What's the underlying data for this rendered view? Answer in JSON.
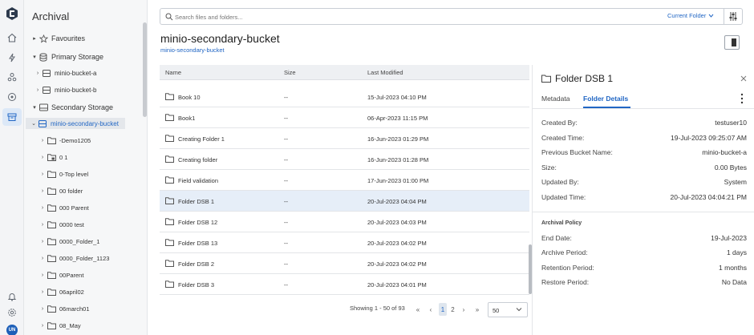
{
  "sidebar": {
    "title": "Archival",
    "user_initials": "UN",
    "tree": [
      {
        "label": "Favourites",
        "caret": "▸",
        "icon": "star-icon",
        "level": 1
      },
      {
        "label": "Primary Storage",
        "caret": "▾",
        "icon": "database-icon",
        "level": 1
      },
      {
        "label": "minio-bucket-a",
        "caret": "›",
        "icon": "bucket-icon",
        "level": 2
      },
      {
        "label": "minio-bucket-b",
        "caret": "›",
        "icon": "bucket-icon",
        "level": 2
      },
      {
        "label": "Secondary Storage",
        "caret": "▾",
        "icon": "storage-icon",
        "level": 1
      },
      {
        "label": "minio-secondary-bucket",
        "caret": "⌄",
        "icon": "bucket-icon",
        "level": 2,
        "selected": true
      },
      {
        "label": "-Demo1205",
        "caret": "›",
        "icon": "folder-icon",
        "level": 3
      },
      {
        "label": "0 1",
        "caret": "›",
        "icon": "folder-lock-icon",
        "level": 3
      },
      {
        "label": "0-Top level",
        "caret": "›",
        "icon": "folder-icon",
        "level": 3
      },
      {
        "label": "00 folder",
        "caret": "›",
        "icon": "folder-icon",
        "level": 3
      },
      {
        "label": "000 Parent",
        "caret": "›",
        "icon": "folder-icon",
        "level": 3
      },
      {
        "label": "0000 test",
        "caret": "›",
        "icon": "folder-icon",
        "level": 3
      },
      {
        "label": "0000_Folder_1",
        "caret": "›",
        "icon": "folder-icon",
        "level": 3
      },
      {
        "label": "0000_Folder_1123",
        "caret": "›",
        "icon": "folder-icon",
        "level": 3
      },
      {
        "label": "00Parent",
        "caret": "›",
        "icon": "folder-icon",
        "level": 3
      },
      {
        "label": "06april02",
        "caret": "›",
        "icon": "folder-icon",
        "level": 3
      },
      {
        "label": "06march01",
        "caret": "›",
        "icon": "folder-icon",
        "level": 3
      },
      {
        "label": "08_May",
        "caret": "›",
        "icon": "folder-icon",
        "level": 3
      }
    ]
  },
  "search": {
    "placeholder": "Search files and folders...",
    "scope": "Current Folder"
  },
  "main": {
    "title": "minio-secondary-bucket",
    "breadcrumb": "minio-secondary-bucket"
  },
  "table": {
    "headers": {
      "name": "Name",
      "size": "Size",
      "modified": "Last Modified"
    },
    "rows": [
      {
        "name": "Book 10",
        "size": "--",
        "modified": "15-Jul-2023 04:10 PM"
      },
      {
        "name": "Book1",
        "size": "--",
        "modified": "06-Apr-2023 11:15 PM"
      },
      {
        "name": "Creating Folder 1",
        "size": "--",
        "modified": "16-Jun-2023 01:29 PM"
      },
      {
        "name": "Creating folder",
        "size": "--",
        "modified": "16-Jun-2023 01:28 PM"
      },
      {
        "name": "Field validation",
        "size": "--",
        "modified": "17-Jun-2023 01:00 PM"
      },
      {
        "name": "Folder DSB 1",
        "size": "--",
        "modified": "20-Jul-2023 04:04 PM",
        "selected": true
      },
      {
        "name": "Folder DSB 12",
        "size": "--",
        "modified": "20-Jul-2023 04:03 PM"
      },
      {
        "name": "Folder DSB 13",
        "size": "--",
        "modified": "20-Jul-2023 04:02 PM"
      },
      {
        "name": "Folder DSB 2",
        "size": "--",
        "modified": "20-Jul-2023 04:02 PM"
      },
      {
        "name": "Folder DSB 3",
        "size": "--",
        "modified": "20-Jul-2023 04:01 PM"
      }
    ]
  },
  "pagination": {
    "summary": "Showing 1 - 50 of 93",
    "first": "«",
    "prev": "‹",
    "pages": [
      "1",
      "2"
    ],
    "current_page": "1",
    "next": "›",
    "last": "»",
    "page_size": "50"
  },
  "details": {
    "title": "Folder DSB 1",
    "tabs": [
      "Metadata",
      "Folder Details"
    ],
    "active_tab": "Folder Details",
    "fields": [
      {
        "key": "Created By:",
        "value": "testuser10"
      },
      {
        "key": "Created Time:",
        "value": "19-Jul-2023 09:25:07 AM"
      },
      {
        "key": "Previous Bucket Name:",
        "value": "minio-bucket-a"
      },
      {
        "key": "Size:",
        "value": "0.00 Bytes"
      },
      {
        "key": "Updated By:",
        "value": "System"
      },
      {
        "key": "Updated Time:",
        "value": "20-Jul-2023 04:04:21 PM"
      }
    ],
    "policy_title": "Archival Policy",
    "policy": [
      {
        "key": "End Date:",
        "value": "19-Jul-2023"
      },
      {
        "key": "Archive Period:",
        "value": "1 days"
      },
      {
        "key": "Retention Period:",
        "value": "1 months"
      },
      {
        "key": "Restore Period:",
        "value": "No Data"
      }
    ]
  },
  "colors": {
    "accent": "#2166c4",
    "selected_row": "#e6eef8",
    "sidebar_bg": "#f6f7f8"
  }
}
